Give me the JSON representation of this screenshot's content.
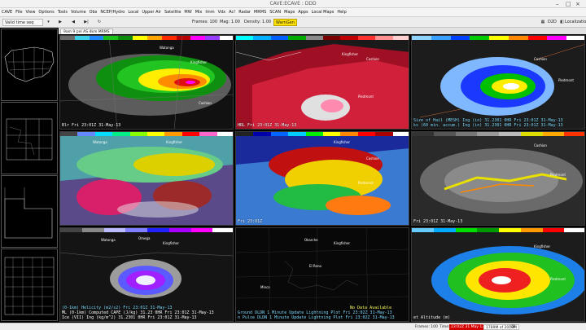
{
  "window": {
    "title": "CAVE:ECAVE : DDD",
    "controls": [
      "–",
      "□",
      "×"
    ]
  },
  "menu": [
    "CAVE",
    "File",
    "View",
    "Options",
    "Tools",
    "Volume",
    "Obs",
    "NCEP/Hydro",
    "Local",
    "Upper Air",
    "Satellite",
    "MW",
    "Mix",
    "Imm",
    "Vdx",
    "Ac!",
    "Radar",
    "MRMS",
    "SCAN",
    "Maps",
    "Apps",
    "Local Maps",
    "Help"
  ],
  "toolbar": {
    "load_mode": "Valid time seq",
    "frames_label": "Frames: 100",
    "mag_label": "Mag: 1.00",
    "density_label": "Density: 1.00",
    "warn_label": "WarnGen",
    "perspective": "D2D",
    "localization": "Localization"
  },
  "tab": {
    "label": "9am 9 pnl AS 4km MRMS"
  },
  "panels": [
    {
      "line1": "Blr  Fri 23:01Z 31-May-13",
      "line2": "",
      "line3": ""
    },
    {
      "line1": "HRL  Fri 23:01Z 31-May-13",
      "line2": "",
      "line3": ""
    },
    {
      "line1": "ks (60 min. accum.) Ing (in)    31.2301  0HR Fri 23:01Z 31-May-13",
      "line2": "Size of Hail (MESH) Ing (in)    31.2301  0HR Fri 23:01Z 31-May-13",
      "line3": ""
    },
    {
      "line1": "",
      "line2": "",
      "line3": ""
    },
    {
      "line1": "Fri 23:01Z",
      "line2": "",
      "line3": ""
    },
    {
      "line1": "Fri 23:01Z 31-May-13",
      "line2": "",
      "line3": ""
    },
    {
      "line1": "Ice (VII) Ing (kg/m^2)    31.2301  0HR Fri 23:01Z 31-May-13",
      "line2": "ML (0-1km) Computed CAPE (J/kg)   31.23  0HR Fri 23:01Z 31-May-13",
      "line3": "(0-1km) Helicity (m2/s2)  Fri 23:01Z 31-May-13"
    },
    {
      "line1": "n Pulse DLDN 1 Minute Update Lightning Plot  Fri 23:02Z 31-May-13",
      "line2": "Ground DLDN 1 Minute Update Lightning Plot  Fri 23:02Z 31-May-13",
      "line3": "No Data Available"
    },
    {
      "line1": "et Altitude (m)",
      "line2": "",
      "line3": ""
    }
  ],
  "cities": [
    "Watonga",
    "Kingfisher",
    "Cashion",
    "Piedmont",
    "El Reno",
    "Okarche",
    "Union City",
    "Minco",
    "Calumet",
    "Hinton",
    "Geary",
    "Omega"
  ],
  "statusbar": {
    "frames": "Frames: 100",
    "time": "Time:",
    "time_value": "23:02Z 31 May 13",
    "memory": "1789M of 2010M"
  },
  "colors": {
    "warn": "#ffe100",
    "status_time": "#d40000"
  }
}
